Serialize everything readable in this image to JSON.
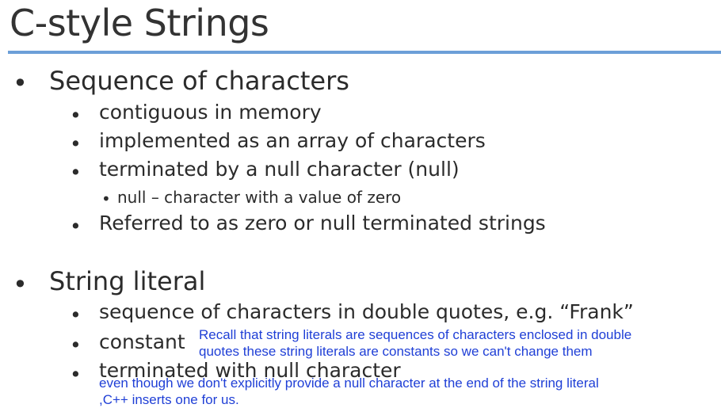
{
  "slide": {
    "title": "C-style Strings",
    "bullet_glyph": "•"
  },
  "section1": {
    "heading": "Sequence of characters",
    "items": [
      "contiguous in memory",
      "implemented as an array of characters",
      "terminated by a null character (null)",
      "Referred to as zero or null terminated strings"
    ],
    "subitem": "null – character with a value of zero"
  },
  "section2": {
    "heading": "String literal",
    "items": [
      "sequence of characters in double quotes, e.g. “Frank”",
      "constant",
      "terminated with null character"
    ]
  },
  "annotations": {
    "note1_line1": "Recall that string literals are sequences of characters enclosed in double",
    "note1_line2": "quotes these string literals are constants so we can't change them",
    "note2_line1": "even though we don't explicitly provide a null character at the end of the string literal",
    "note2_line2": ",C++ inserts one for us."
  },
  "colors": {
    "accent_rule": "#6c9fd8",
    "annotation_text": "#1f3fd6"
  }
}
